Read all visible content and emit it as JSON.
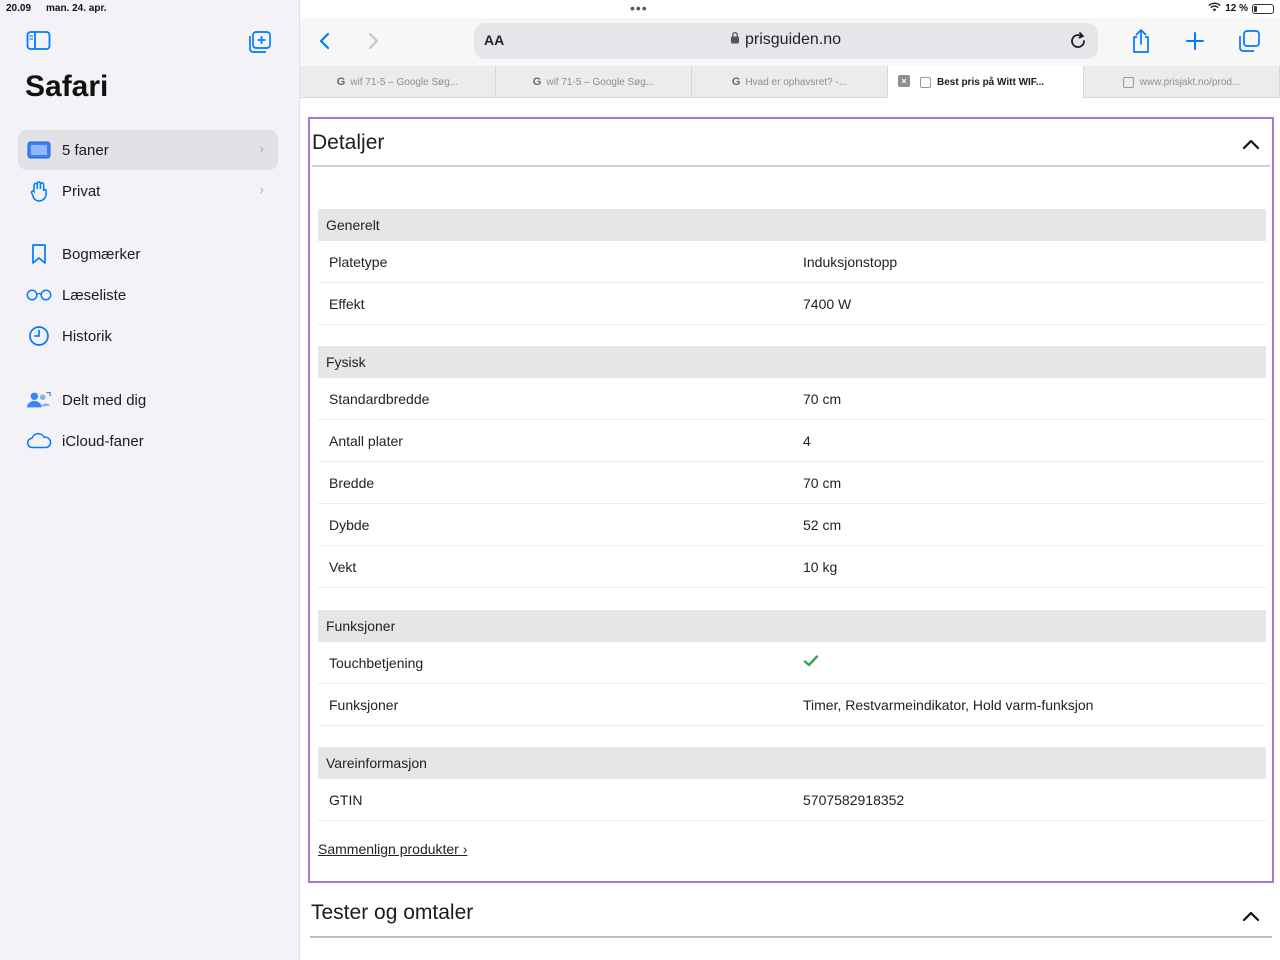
{
  "status": {
    "time": "20.09",
    "date": "man. 24. apr.",
    "battery": "12 %",
    "multitask_dots": "•••"
  },
  "sidebar": {
    "title": "Safari",
    "items": [
      {
        "label": "5 faner",
        "icon": "tabs-icon"
      },
      {
        "label": "Privat",
        "icon": "hand-icon"
      },
      {
        "label": "Bogmærker",
        "icon": "bookmark-icon"
      },
      {
        "label": "Læseliste",
        "icon": "glasses-icon"
      },
      {
        "label": "Historik",
        "icon": "clock-icon"
      },
      {
        "label": "Delt med dig",
        "icon": "shared-people-icon"
      },
      {
        "label": "iCloud-faner",
        "icon": "cloud-icon"
      }
    ]
  },
  "toolbar": {
    "aa": "AA",
    "url": "prisguiden.no"
  },
  "tabs": [
    {
      "label": "wif 71-5 – Google Søg...",
      "favicon": "G"
    },
    {
      "label": "wif 71-5 – Google Søg...",
      "favicon": "G"
    },
    {
      "label": "Hvad er ophavsret? -...",
      "favicon": "G"
    },
    {
      "label": "Best pris på Witt WIF..."
    },
    {
      "label": "www.prisjakt.no/prod..."
    }
  ],
  "details": {
    "title": "Detaljer",
    "sections": [
      {
        "title": "Generelt",
        "rows": [
          {
            "label": "Platetype",
            "value": "Induksjonstopp"
          },
          {
            "label": "Effekt",
            "value": "7400 W"
          }
        ]
      },
      {
        "title": "Fysisk",
        "rows": [
          {
            "label": "Standardbredde",
            "value": "70 cm"
          },
          {
            "label": "Antall plater",
            "value": "4"
          },
          {
            "label": "Bredde",
            "value": "70 cm"
          },
          {
            "label": "Dybde",
            "value": "52 cm"
          },
          {
            "label": "Vekt",
            "value": "10 kg"
          }
        ]
      },
      {
        "title": "Funksjoner",
        "rows": [
          {
            "label": "Touchbetjening",
            "value": "",
            "icon": "checkmark-icon"
          },
          {
            "label": "Funksjoner",
            "value": "Timer, Restvarmeindikator, Hold varm-funksjon"
          }
        ]
      },
      {
        "title": "Vareinformasjon",
        "rows": [
          {
            "label": "GTIN",
            "value": "5707582918352"
          }
        ]
      }
    ],
    "compare_link": "Sammenlign produkter ›"
  },
  "reviews": {
    "title": "Tester og omtaler"
  },
  "colors": {
    "accent": "#007aff",
    "highlight_border": "#a678d6",
    "check": "#34a853"
  }
}
